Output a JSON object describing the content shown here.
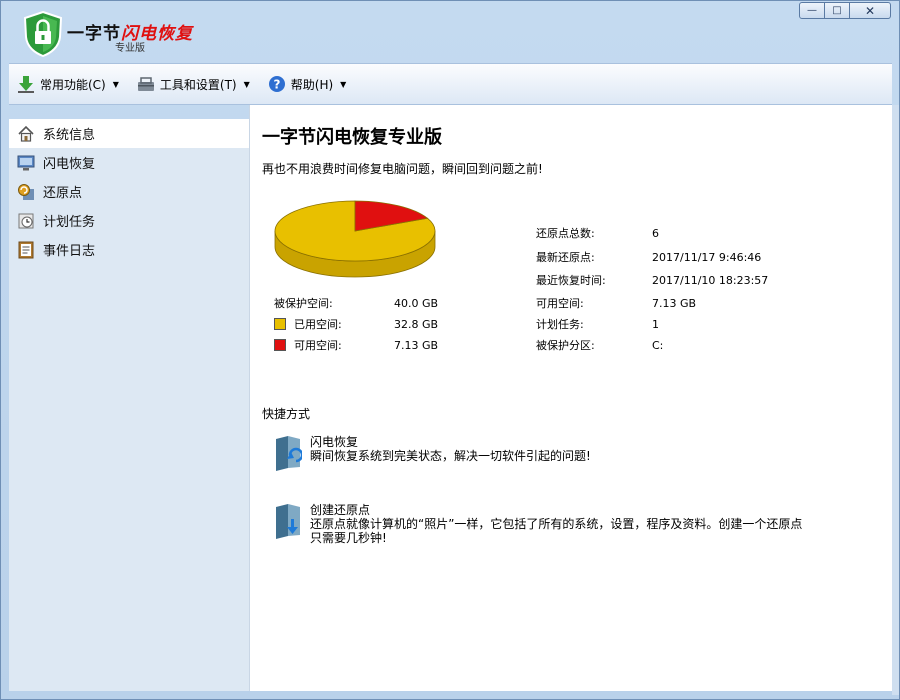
{
  "window": {
    "title_prefix": "一字节",
    "title_highlight": "闪电恢复",
    "subtitle": "专业版",
    "buttons": {
      "minimize": "—",
      "maximize": "□",
      "close": "✕"
    }
  },
  "toolbar": {
    "items": [
      {
        "label": "常用功能(C)",
        "icon": "download-arrow-icon"
      },
      {
        "label": "工具和设置(T)",
        "icon": "tools-icon"
      },
      {
        "label": "帮助(H)",
        "icon": "help-icon"
      }
    ],
    "caret": "▼"
  },
  "sidebar": {
    "items": [
      {
        "label": "系统信息",
        "icon": "home-icon",
        "active": true
      },
      {
        "label": "闪电恢复",
        "icon": "monitor-icon",
        "active": false
      },
      {
        "label": "还原点",
        "icon": "restore-point-icon",
        "active": false
      },
      {
        "label": "计划任务",
        "icon": "clock-icon",
        "active": false
      },
      {
        "label": "事件日志",
        "icon": "log-icon",
        "active": false
      }
    ]
  },
  "main": {
    "title": "一字节闪电恢复专业版",
    "subtitle": "再也不用浪费时间修复电脑问题，瞬间回到问题之前!",
    "disk": {
      "protected_label": "被保护空间:",
      "protected_value": "40.0 GB",
      "used_label": "已用空间:",
      "used_value": "32.8 GB",
      "free_label": "可用空间:",
      "free_value": "7.13 GB",
      "used_fraction": 0.82,
      "used_color": "#e8c000",
      "free_color": "#e01010"
    },
    "stats": [
      {
        "label": "还原点总数:",
        "value": "6"
      },
      {
        "label": "最新还原点:",
        "value": "2017/11/17 9:46:46"
      },
      {
        "label": "最近恢复时间:",
        "value": "2017/11/10 18:23:57"
      },
      {
        "label": "可用空间:",
        "value": "7.13 GB"
      },
      {
        "label": "计划任务:",
        "value": "1"
      },
      {
        "label": "被保护分区:",
        "value": "C:"
      }
    ],
    "shortcuts_title": "快捷方式",
    "shortcuts": [
      {
        "title": "闪电恢复",
        "desc": "瞬间恢复系统到完美状态，解决一切软件引起的问题!"
      },
      {
        "title": "创建还原点",
        "desc": "还原点就像计算机的“照片”一样，它包括了所有的系统，设置，程序及资料。创建一个还原点只需要几秒钟!"
      }
    ]
  }
}
